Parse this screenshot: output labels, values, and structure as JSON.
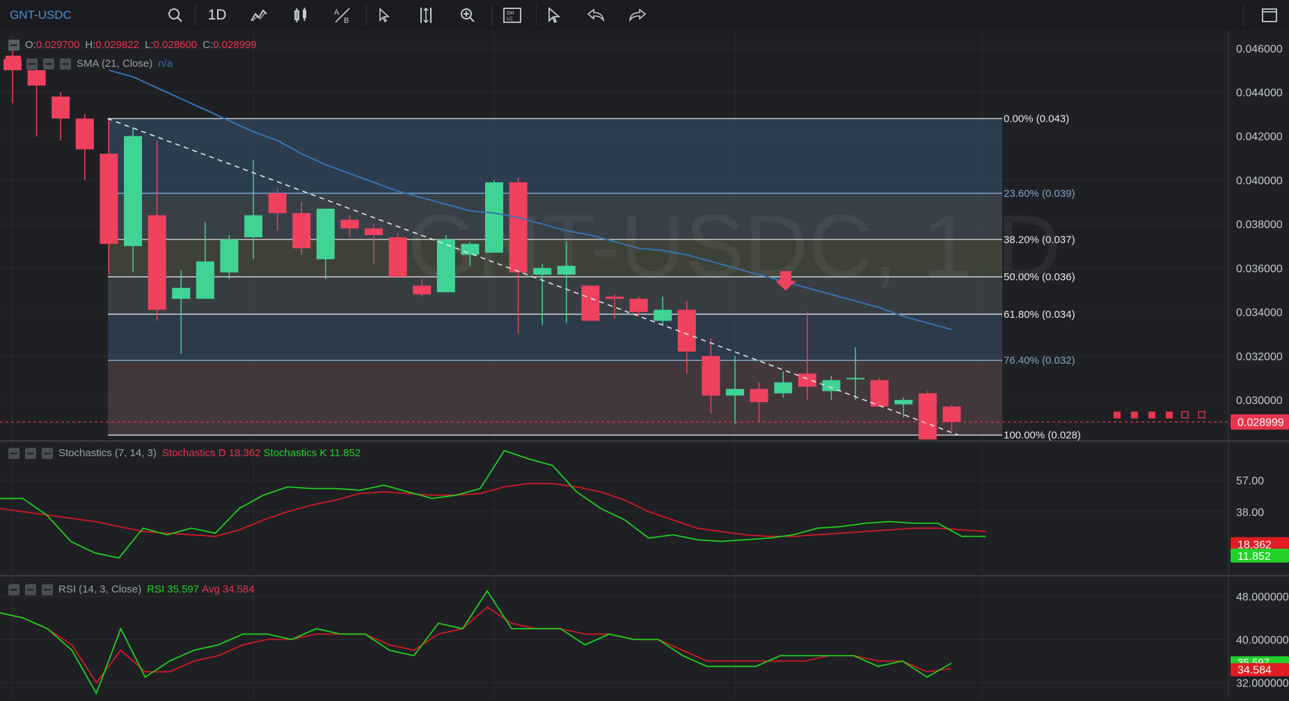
{
  "toolbar": {
    "symbol": "GNT-USDC",
    "timeframe": "1D",
    "icons": [
      "search-icon",
      "indicators-icon",
      "candle-type-icon",
      "compare-icon",
      "cursor-icon",
      "measure-icon",
      "zoom-icon",
      "ohlc-icon",
      "arrow-tool-icon",
      "undo-icon",
      "redo-icon",
      "fullscreen-icon"
    ]
  },
  "watermark": "GNT-USDC, 1 D",
  "ohlc": {
    "o_label": "O:",
    "o": "0.029700",
    "h_label": "H:",
    "h": "0.029822",
    "l_label": "L:",
    "l": "0.028600",
    "c_label": "C:",
    "c": "0.028999"
  },
  "sma_legend": {
    "label": "SMA (21, Close)",
    "value": "n/a"
  },
  "stoch_legend": {
    "label": "Stochastics (7, 14, 3)",
    "d_label": "Stochastics D",
    "d_value": "18.362",
    "k_label": "Stochastics K",
    "k_value": "11.852"
  },
  "rsi_legend": {
    "label": "RSI (14, 3, Close)",
    "rsi_label": "RSI",
    "rsi_value": "35.597",
    "avg_label": "Avg",
    "avg_value": "34.584"
  },
  "colors": {
    "up": "#3fd494",
    "down": "#f0415f",
    "sma": "#3a73b3",
    "stoch_d": "#d31a24",
    "stoch_k": "#21cf21",
    "bg": "#1f2024"
  },
  "price_axis": {
    "ticks": [
      "0.046000",
      "0.044000",
      "0.042000",
      "0.040000",
      "0.038000",
      "0.036000",
      "0.034000",
      "0.032000",
      "0.030000"
    ],
    "last_price": "0.028999"
  },
  "stoch_axis": {
    "ticks": [
      "57.00",
      "38.00"
    ],
    "d_tag": "18.362",
    "k_tag": "11.852"
  },
  "rsi_axis": {
    "ticks": [
      "48.000000",
      "40.000000",
      "32.000000"
    ],
    "rsi_tag": "35.597",
    "avg_tag": "34.584"
  },
  "fibonacci": [
    {
      "label": "0.00% (0.043)",
      "price": 0.0428
    },
    {
      "label": "23.60% (0.039)",
      "price": 0.0394
    },
    {
      "label": "38.20% (0.037)",
      "price": 0.0373
    },
    {
      "label": "50.00% (0.036)",
      "price": 0.0356
    },
    {
      "label": "61.80% (0.034)",
      "price": 0.0339
    },
    {
      "label": "76.40% (0.032)",
      "price": 0.0318
    },
    {
      "label": "100.00% (0.028)",
      "price": 0.0284
    }
  ],
  "chart_data": {
    "type": "candlestick",
    "price_range": [
      0.0282,
      0.0468
    ],
    "candles": [
      {
        "o": 0.0455,
        "h": 0.0462,
        "l": 0.0435,
        "c": 0.045
      },
      {
        "o": 0.045,
        "h": 0.0452,
        "l": 0.042,
        "c": 0.0443
      },
      {
        "o": 0.0438,
        "h": 0.044,
        "l": 0.0418,
        "c": 0.0428
      },
      {
        "o": 0.0428,
        "h": 0.043,
        "l": 0.04,
        "c": 0.0414
      },
      {
        "o": 0.0412,
        "h": 0.0428,
        "l": 0.0357,
        "c": 0.0371
      },
      {
        "o": 0.037,
        "h": 0.0424,
        "l": 0.0358,
        "c": 0.042
      },
      {
        "o": 0.0384,
        "h": 0.0418,
        "l": 0.0336,
        "c": 0.0341
      },
      {
        "o": 0.0346,
        "h": 0.0359,
        "l": 0.0321,
        "c": 0.0351
      },
      {
        "o": 0.0346,
        "h": 0.0381,
        "l": 0.0346,
        "c": 0.0363
      },
      {
        "o": 0.0358,
        "h": 0.0375,
        "l": 0.0355,
        "c": 0.0373
      },
      {
        "o": 0.0374,
        "h": 0.0409,
        "l": 0.0364,
        "c": 0.0384
      },
      {
        "o": 0.0394,
        "h": 0.0396,
        "l": 0.0377,
        "c": 0.0385
      },
      {
        "o": 0.0385,
        "h": 0.039,
        "l": 0.0366,
        "c": 0.0369
      },
      {
        "o": 0.0364,
        "h": 0.0387,
        "l": 0.0355,
        "c": 0.0387
      },
      {
        "o": 0.0382,
        "h": 0.0384,
        "l": 0.0374,
        "c": 0.0378
      },
      {
        "o": 0.0378,
        "h": 0.038,
        "l": 0.0362,
        "c": 0.0375
      },
      {
        "o": 0.0374,
        "h": 0.0376,
        "l": 0.0356,
        "c": 0.0356
      },
      {
        "o": 0.0352,
        "h": 0.0355,
        "l": 0.0347,
        "c": 0.0348
      },
      {
        "o": 0.0349,
        "h": 0.0375,
        "l": 0.0349,
        "c": 0.0373
      },
      {
        "o": 0.0366,
        "h": 0.0372,
        "l": 0.0361,
        "c": 0.0371
      },
      {
        "o": 0.0367,
        "h": 0.04,
        "l": 0.0367,
        "c": 0.0399
      },
      {
        "o": 0.0399,
        "h": 0.0401,
        "l": 0.033,
        "c": 0.0358
      },
      {
        "o": 0.0357,
        "h": 0.0362,
        "l": 0.0334,
        "c": 0.036
      },
      {
        "o": 0.0357,
        "h": 0.0372,
        "l": 0.0335,
        "c": 0.0361
      },
      {
        "o": 0.0352,
        "h": 0.0352,
        "l": 0.0337,
        "c": 0.0336
      },
      {
        "o": 0.0347,
        "h": 0.0348,
        "l": 0.0337,
        "c": 0.0346
      },
      {
        "o": 0.0346,
        "h": 0.0347,
        "l": 0.0338,
        "c": 0.034
      },
      {
        "o": 0.0336,
        "h": 0.0347,
        "l": 0.0334,
        "c": 0.0341
      },
      {
        "o": 0.0341,
        "h": 0.0345,
        "l": 0.0312,
        "c": 0.0322
      },
      {
        "o": 0.032,
        "h": 0.0328,
        "l": 0.0294,
        "c": 0.0302
      },
      {
        "o": 0.0302,
        "h": 0.032,
        "l": 0.0289,
        "c": 0.0305
      },
      {
        "o": 0.0305,
        "h": 0.0308,
        "l": 0.029,
        "c": 0.0299
      },
      {
        "o": 0.0303,
        "h": 0.0313,
        "l": 0.0301,
        "c": 0.0308
      },
      {
        "o": 0.0312,
        "h": 0.034,
        "l": 0.03,
        "c": 0.0306
      },
      {
        "o": 0.0304,
        "h": 0.0311,
        "l": 0.03,
        "c": 0.0309
      },
      {
        "o": 0.031,
        "h": 0.0324,
        "l": 0.03,
        "c": 0.031
      },
      {
        "o": 0.0309,
        "h": 0.031,
        "l": 0.0297,
        "c": 0.0297
      },
      {
        "o": 0.0298,
        "h": 0.0301,
        "l": 0.0292,
        "c": 0.03
      },
      {
        "o": 0.0303,
        "h": 0.0304,
        "l": 0.0282,
        "c": 0.0282
      },
      {
        "o": 0.0297,
        "h": 0.0298,
        "l": 0.0286,
        "c": 0.029
      }
    ],
    "sma": [
      null,
      null,
      null,
      null,
      0.045,
      0.0447,
      0.0442,
      0.0437,
      0.0432,
      0.0427,
      0.0422,
      0.0418,
      0.0412,
      0.0407,
      0.0403,
      0.0399,
      0.0395,
      0.0392,
      0.0389,
      0.0386,
      0.0385,
      0.0383,
      0.038,
      0.0377,
      0.0375,
      0.0372,
      0.0369,
      0.0368,
      0.0366,
      0.0363,
      0.036,
      0.0357,
      0.0354,
      0.0351,
      0.0348,
      0.0345,
      0.0342,
      0.0338,
      0.0335,
      0.0332
    ],
    "stochastics": {
      "range": [
        0,
        80
      ],
      "k": [
        46,
        46,
        36,
        20,
        13,
        10,
        28,
        24,
        28,
        25,
        40,
        48,
        53,
        52,
        52,
        51,
        54,
        50,
        46,
        48,
        52,
        75,
        70,
        66,
        50,
        40,
        33,
        22,
        24,
        21,
        20,
        21,
        22,
        24,
        28,
        29,
        31,
        32,
        31,
        31,
        23,
        23
      ],
      "d": [
        40,
        38,
        36,
        34,
        32,
        29,
        26,
        25,
        24,
        23,
        27,
        33,
        38,
        42,
        45,
        49,
        50,
        49,
        48,
        48,
        49,
        53,
        55,
        55,
        53,
        50,
        45,
        38,
        33,
        28,
        26,
        24,
        23,
        23,
        24,
        25,
        26,
        27,
        28,
        28,
        27,
        26
      ]
    },
    "rsi": {
      "range": [
        30,
        50
      ],
      "rsi": [
        45,
        44,
        42,
        38,
        30,
        42,
        33,
        36,
        38,
        39,
        41,
        41,
        40,
        42,
        41,
        41,
        38,
        37,
        43,
        42,
        49,
        42,
        42,
        42,
        39,
        41,
        40,
        40,
        37,
        35,
        35,
        35,
        37,
        37,
        37,
        37,
        35,
        36,
        33,
        35.597
      ],
      "avg": [
        45,
        44,
        42,
        39,
        32,
        38,
        34,
        34,
        36,
        37,
        39,
        40,
        40,
        41,
        41,
        41,
        39,
        38,
        41,
        42,
        46,
        43,
        42,
        42,
        41,
        41,
        40,
        40,
        38,
        36,
        36,
        36,
        36,
        36,
        37,
        37,
        36,
        36,
        34,
        34.584
      ]
    }
  }
}
